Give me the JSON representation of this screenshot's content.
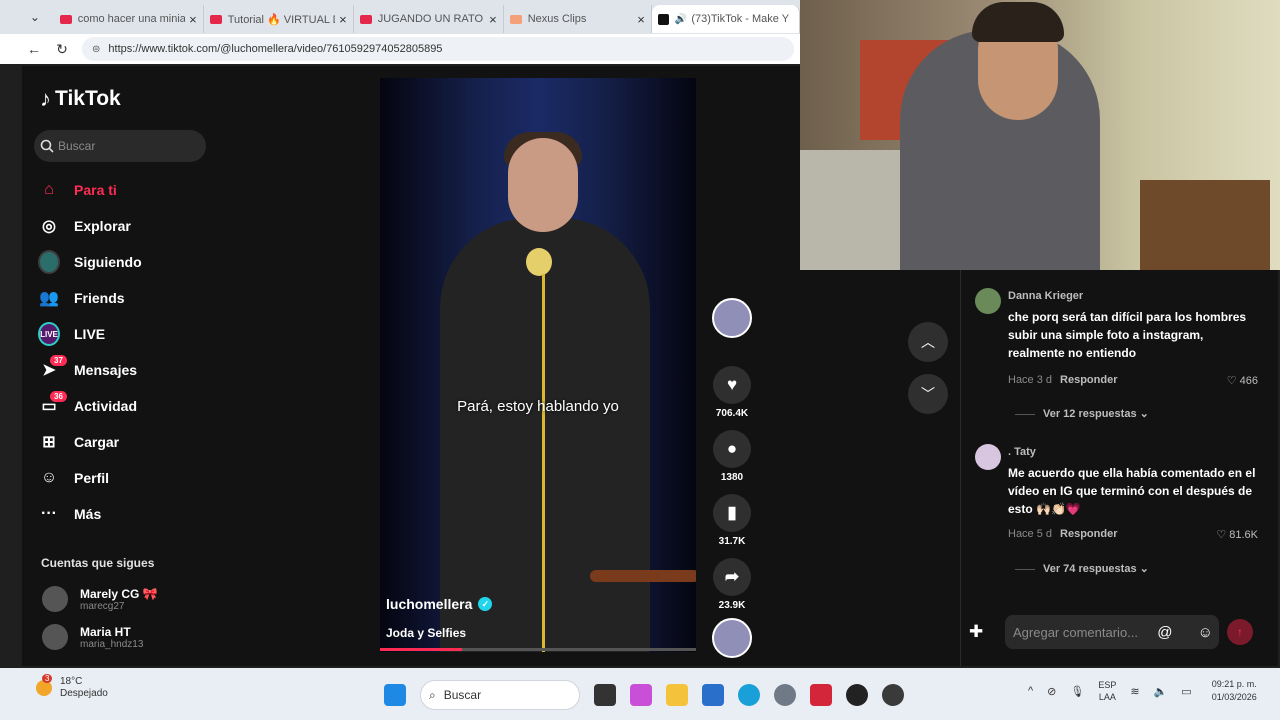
{
  "browser": {
    "tabs": [
      {
        "title": "como hacer una miniat",
        "fav": "youtube-icon"
      },
      {
        "title": "Tutorial 🔥 VIRTUAL D",
        "fav": "youtube-icon"
      },
      {
        "title": "JUGANDO UN RATO - Y",
        "fav": "youtube-icon"
      },
      {
        "title": "Nexus Clips",
        "fav": "nexus-icon"
      },
      {
        "title": "(73)TikTok - Make Y",
        "fav": "tiktok-icon"
      }
    ],
    "url": "https://www.tiktok.com/@luchomellera/video/7610592974052805895"
  },
  "sidebar": {
    "logo": "TikTok",
    "search_placeholder": "Buscar",
    "items": [
      {
        "label": "Para ti",
        "icon": "home-icon"
      },
      {
        "label": "Explorar",
        "icon": "compass-icon"
      },
      {
        "label": "Siguiendo",
        "icon": "following-icon"
      },
      {
        "label": "Friends",
        "icon": "friends-icon"
      },
      {
        "label": "LIVE",
        "icon": "live-icon"
      },
      {
        "label": "Mensajes",
        "icon": "messages-icon",
        "badge": "37"
      },
      {
        "label": "Actividad",
        "icon": "activity-icon",
        "badge": "36"
      },
      {
        "label": "Cargar",
        "icon": "upload-icon"
      },
      {
        "label": "Perfil",
        "icon": "profile-icon"
      },
      {
        "label": "Más",
        "icon": "more-icon"
      }
    ],
    "following_header": "Cuentas que sigues",
    "following": [
      {
        "name": "Marely CG 🎀",
        "handle": "marecg27"
      },
      {
        "name": "Maria HT",
        "handle": "maria_hndz13"
      }
    ]
  },
  "video": {
    "subtitle": "Pará, estoy hablando yo",
    "username": "luchomellera",
    "description": "Joda y Selfies",
    "progress": 0.26
  },
  "actions": {
    "likes": "706.4K",
    "comments": "1380",
    "saves": "31.7K",
    "shares": "23.9K"
  },
  "comments": [
    {
      "user": "Danna Krieger",
      "text": "che porq será tan difícil para los hombres subir una simple foto a instagram, realmente no entiendo",
      "time": "Hace 3 d",
      "reply": "Responder",
      "likes": "466",
      "more": "Ver 12 respuestas"
    },
    {
      "user": ". Taty",
      "text": "Me acuerdo que ella había comentado en el vídeo en IG que terminó con el después de esto 🙌🏻👏🏻💗",
      "time": "Hace 5 d",
      "reply": "Responder",
      "likes": "81.6K",
      "more": "Ver 74 respuestas"
    }
  ],
  "comment_input": {
    "placeholder": "Agregar comentario..."
  },
  "taskbar": {
    "weather_temp": "18°C",
    "weather_desc": "Despejado",
    "weather_badge": "3",
    "search": "Buscar",
    "lang1": "ESP",
    "lang2": "LAA",
    "time": "09:21 p. m.",
    "date": "01/03/2026"
  },
  "colors": {
    "accent": "#fe2c55",
    "bg": "#121212"
  }
}
